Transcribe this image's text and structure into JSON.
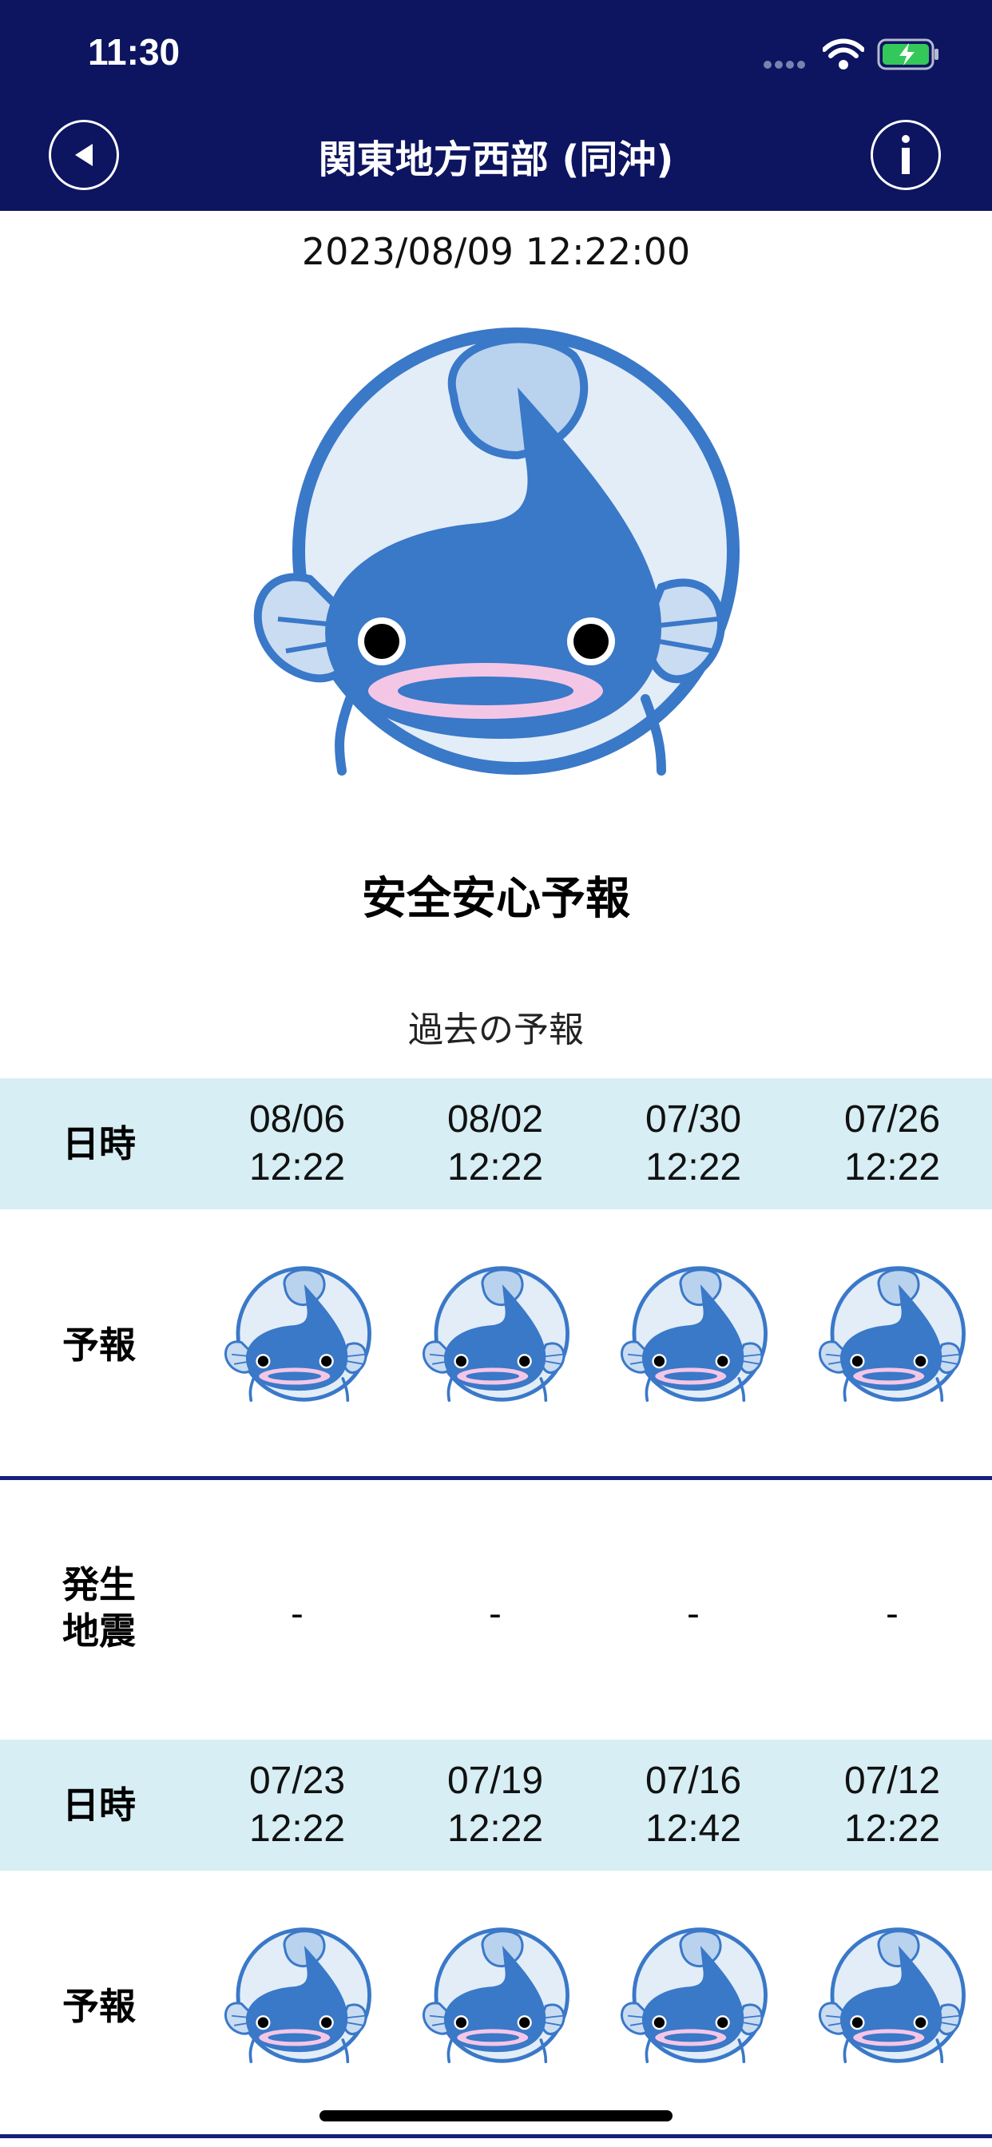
{
  "status_bar": {
    "time": "11:30"
  },
  "header": {
    "title": "関東地方西部 (同沖)"
  },
  "timestamp": "2023/08/09 12:22:00",
  "current_forecast": {
    "label": "安全安心予報"
  },
  "past_section": {
    "label": "過去の予報"
  },
  "labels": {
    "datetime": "日時",
    "forecast": "予報",
    "quake_line1": "発生",
    "quake_line2": "地震"
  },
  "history": [
    {
      "entries": [
        {
          "date": "08/06",
          "time": "12:22",
          "quake": "-"
        },
        {
          "date": "08/02",
          "time": "12:22",
          "quake": "-"
        },
        {
          "date": "07/30",
          "time": "12:22",
          "quake": "-"
        },
        {
          "date": "07/26",
          "time": "12:22",
          "quake": "-"
        }
      ]
    },
    {
      "entries": [
        {
          "date": "07/23",
          "time": "12:22"
        },
        {
          "date": "07/19",
          "time": "12:22"
        },
        {
          "date": "07/16",
          "time": "12:42"
        },
        {
          "date": "07/12",
          "time": "12:22"
        }
      ]
    }
  ],
  "colors": {
    "header_bg": "#0d1460",
    "band_bg": "#d6eef4",
    "divider": "#14207a",
    "catfish_body": "#3a78c8",
    "catfish_ring_bg": "#e2edf8"
  },
  "icons": {
    "back": "back-arrow-icon",
    "info": "info-icon",
    "forecast": "catfish-mascot-icon"
  }
}
